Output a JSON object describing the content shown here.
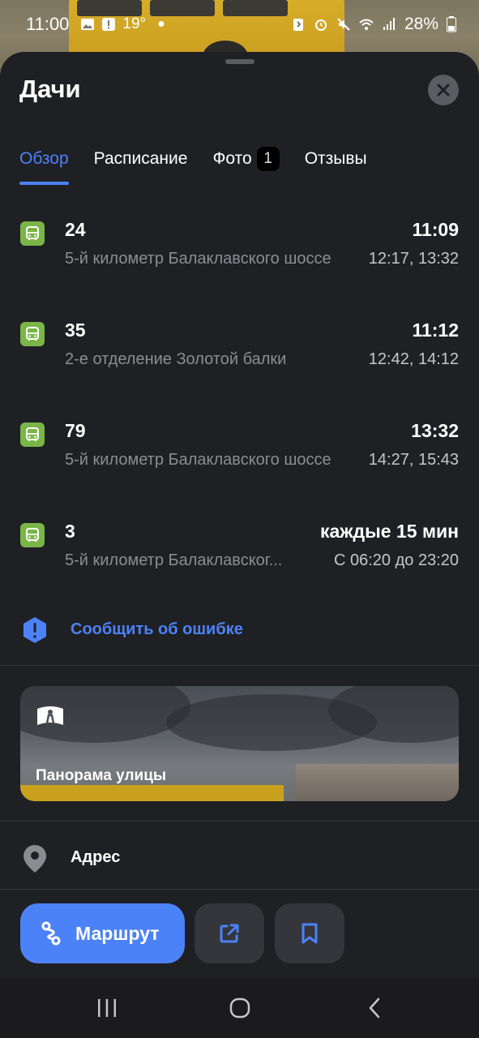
{
  "status_bar": {
    "time": "11:00",
    "temperature": "19°",
    "battery": "28%"
  },
  "stop": {
    "title": "Дачи"
  },
  "tabs": [
    {
      "label": "Обзор",
      "active": true
    },
    {
      "label": "Расписание",
      "active": false
    },
    {
      "label": "Фото",
      "active": false,
      "badge": "1"
    },
    {
      "label": "Отзывы",
      "active": false
    }
  ],
  "routes": [
    {
      "number": "24",
      "destination": "5-й километр Балаклавского шоссе",
      "next": "11:09",
      "later": "12:17, 13:32"
    },
    {
      "number": "35",
      "destination": "2-е отделение Золотой балки",
      "next": "11:12",
      "later": "12:42, 14:12"
    },
    {
      "number": "79",
      "destination": "5-й километр Балаклавского шоссе",
      "next": "13:32",
      "later": "14:27, 15:43"
    },
    {
      "number": "3",
      "destination": "5-й километр Балаклавског...",
      "next": "каждые 15 мин",
      "later": "С 06:20 до 23:20"
    }
  ],
  "report_error": {
    "label": "Сообщить об ошибке"
  },
  "panorama": {
    "label": "Панорама улицы"
  },
  "address": {
    "label": "Адрес"
  },
  "actions": {
    "route_label": "Маршрут"
  },
  "colors": {
    "accent": "#4c82f7",
    "bus_icon": "#7ab548",
    "background": "#1f2024"
  }
}
